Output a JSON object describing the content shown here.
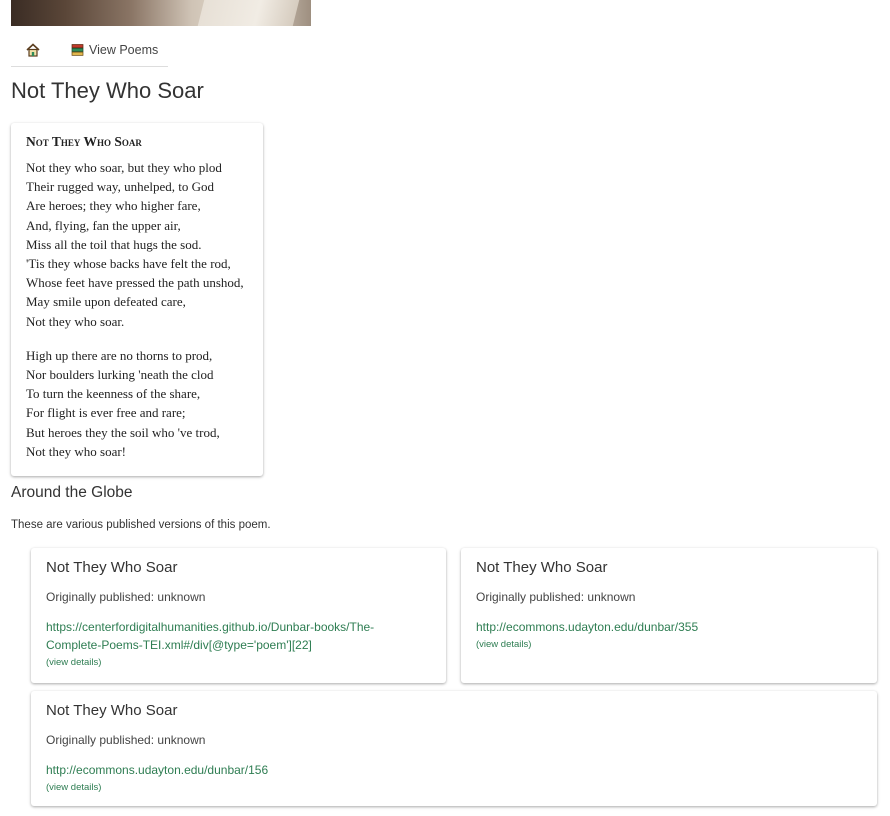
{
  "nav": {
    "poems_label": "View Poems"
  },
  "page_title": "Not They Who Soar",
  "poem": {
    "title": "Not They Who Soar",
    "stanzas": [
      [
        "Not they who soar, but they who plod",
        "Their rugged way, unhelped, to God",
        "Are heroes; they who higher fare,",
        "And, flying, fan the upper air,",
        "Miss all the toil that hugs the sod.",
        "'Tis they whose backs have felt the rod,",
        "Whose feet have pressed the path unshod,",
        "May smile upon defeated care,",
        "Not they who soar."
      ],
      [
        "High up there are no thorns to prod,",
        "Nor boulders lurking 'neath the clod",
        "To turn the keenness of the share,",
        "For flight is ever free and rare;",
        "But heroes they the soil who 've trod,",
        "Not they who soar!"
      ]
    ]
  },
  "section": {
    "title": "Around the Globe",
    "description": "These are various published versions of this poem."
  },
  "versions": [
    {
      "title": "Not They Who Soar",
      "published": "Originally published: unknown",
      "link_lines": [
        "https://centerfordigitalhumanities.github.io/Dunbar-books/The-",
        "Complete-Poems-TEI.xml#/div[@type='poem'][22]"
      ],
      "details_label": "(view details)"
    },
    {
      "title": "Not They Who Soar",
      "published": "Originally published: unknown",
      "link_lines": [
        "http://ecommons.udayton.edu/dunbar/355"
      ],
      "details_label": "(view details)"
    },
    {
      "title": "Not They Who Soar",
      "published": "Originally published: unknown",
      "link_lines": [
        "http://ecommons.udayton.edu/dunbar/156"
      ],
      "details_label": "(view details)"
    }
  ]
}
